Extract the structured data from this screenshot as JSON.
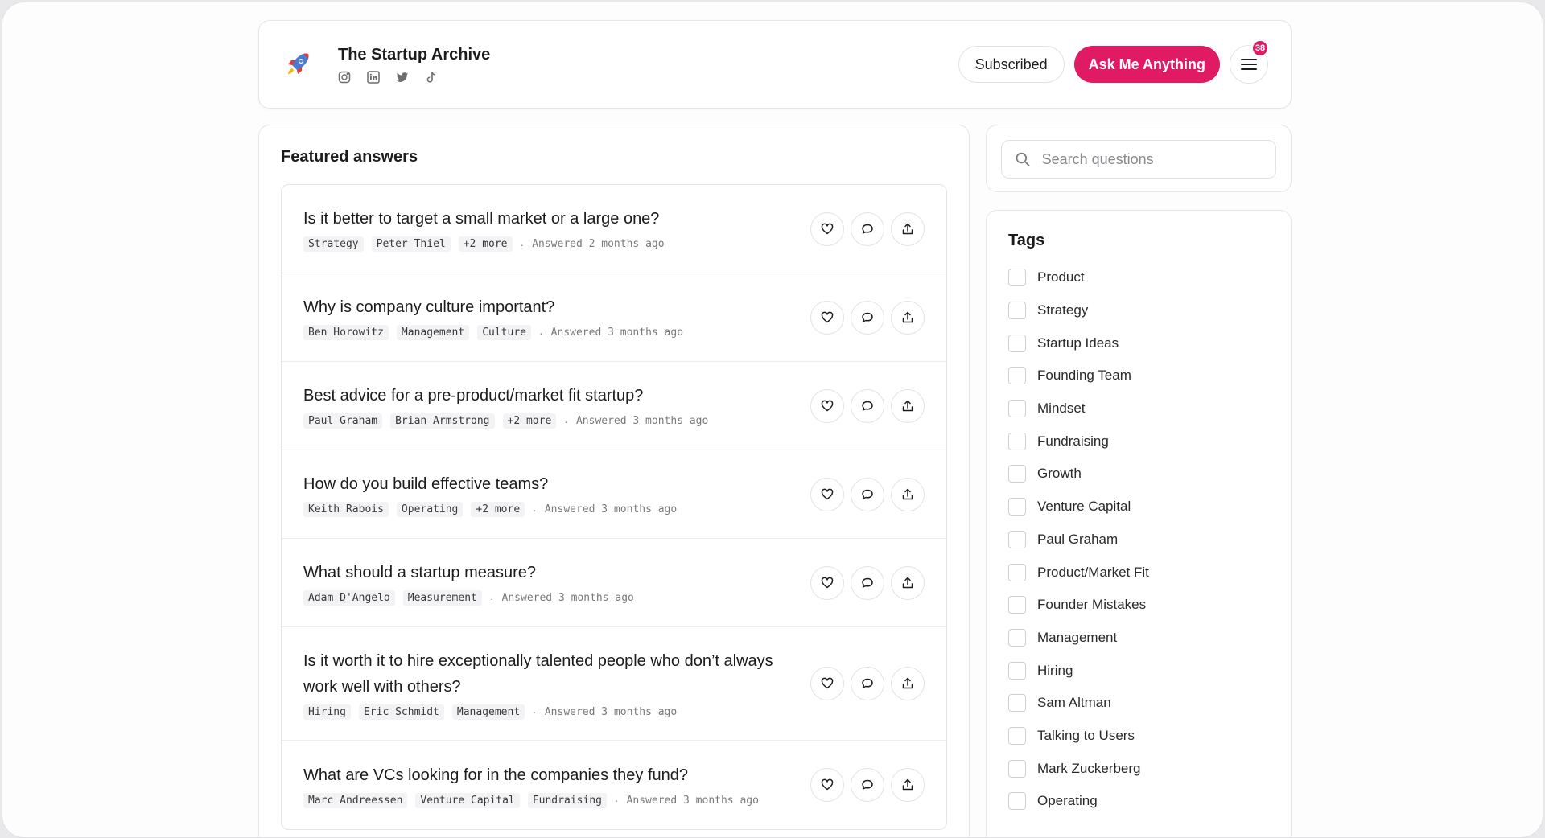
{
  "header": {
    "title": "The Startup Archive",
    "socials": [
      "instagram-icon",
      "linkedin-icon",
      "twitter-icon",
      "tiktok-icon"
    ],
    "subscribed_label": "Subscribed",
    "ask_label": "Ask Me Anything",
    "notification_count": "38"
  },
  "colors": {
    "accent": "#e01a63"
  },
  "main": {
    "title": "Featured answers",
    "questions": [
      {
        "title": "Is it better to target a small market or a large one?",
        "tags": [
          "Strategy",
          "Peter Thiel",
          "+2 more"
        ],
        "answered": "Answered 2 months ago"
      },
      {
        "title": "Why is company culture important?",
        "tags": [
          "Ben Horowitz",
          "Management",
          "Culture"
        ],
        "answered": "Answered 3 months ago"
      },
      {
        "title": "Best advice for a pre-product/market fit startup?",
        "tags": [
          "Paul Graham",
          "Brian Armstrong",
          "+2 more"
        ],
        "answered": "Answered 3 months ago"
      },
      {
        "title": "How do you build effective teams?",
        "tags": [
          "Keith Rabois",
          "Operating",
          "+2 more"
        ],
        "answered": "Answered 3 months ago"
      },
      {
        "title": "What should a startup measure?",
        "tags": [
          "Adam D'Angelo",
          "Measurement"
        ],
        "answered": "Answered 3 months ago"
      },
      {
        "title": "Is it worth it to hire exceptionally talented people who don’t always work well with others?",
        "tags": [
          "Hiring",
          "Eric Schmidt",
          "Management"
        ],
        "answered": "Answered 3 months ago"
      },
      {
        "title": "What are VCs looking for in the companies they fund?",
        "tags": [
          "Marc Andreessen",
          "Venture Capital",
          "Fundraising"
        ],
        "answered": "Answered 3 months ago"
      }
    ]
  },
  "search": {
    "placeholder": "Search questions"
  },
  "tags_panel": {
    "title": "Tags",
    "items": [
      "Product",
      "Strategy",
      "Startup Ideas",
      "Founding Team",
      "Mindset",
      "Fundraising",
      "Growth",
      "Venture Capital",
      "Paul Graham",
      "Product/Market Fit",
      "Founder Mistakes",
      "Management",
      "Hiring",
      "Sam Altman",
      "Talking to Users",
      "Mark Zuckerberg",
      "Operating"
    ]
  }
}
